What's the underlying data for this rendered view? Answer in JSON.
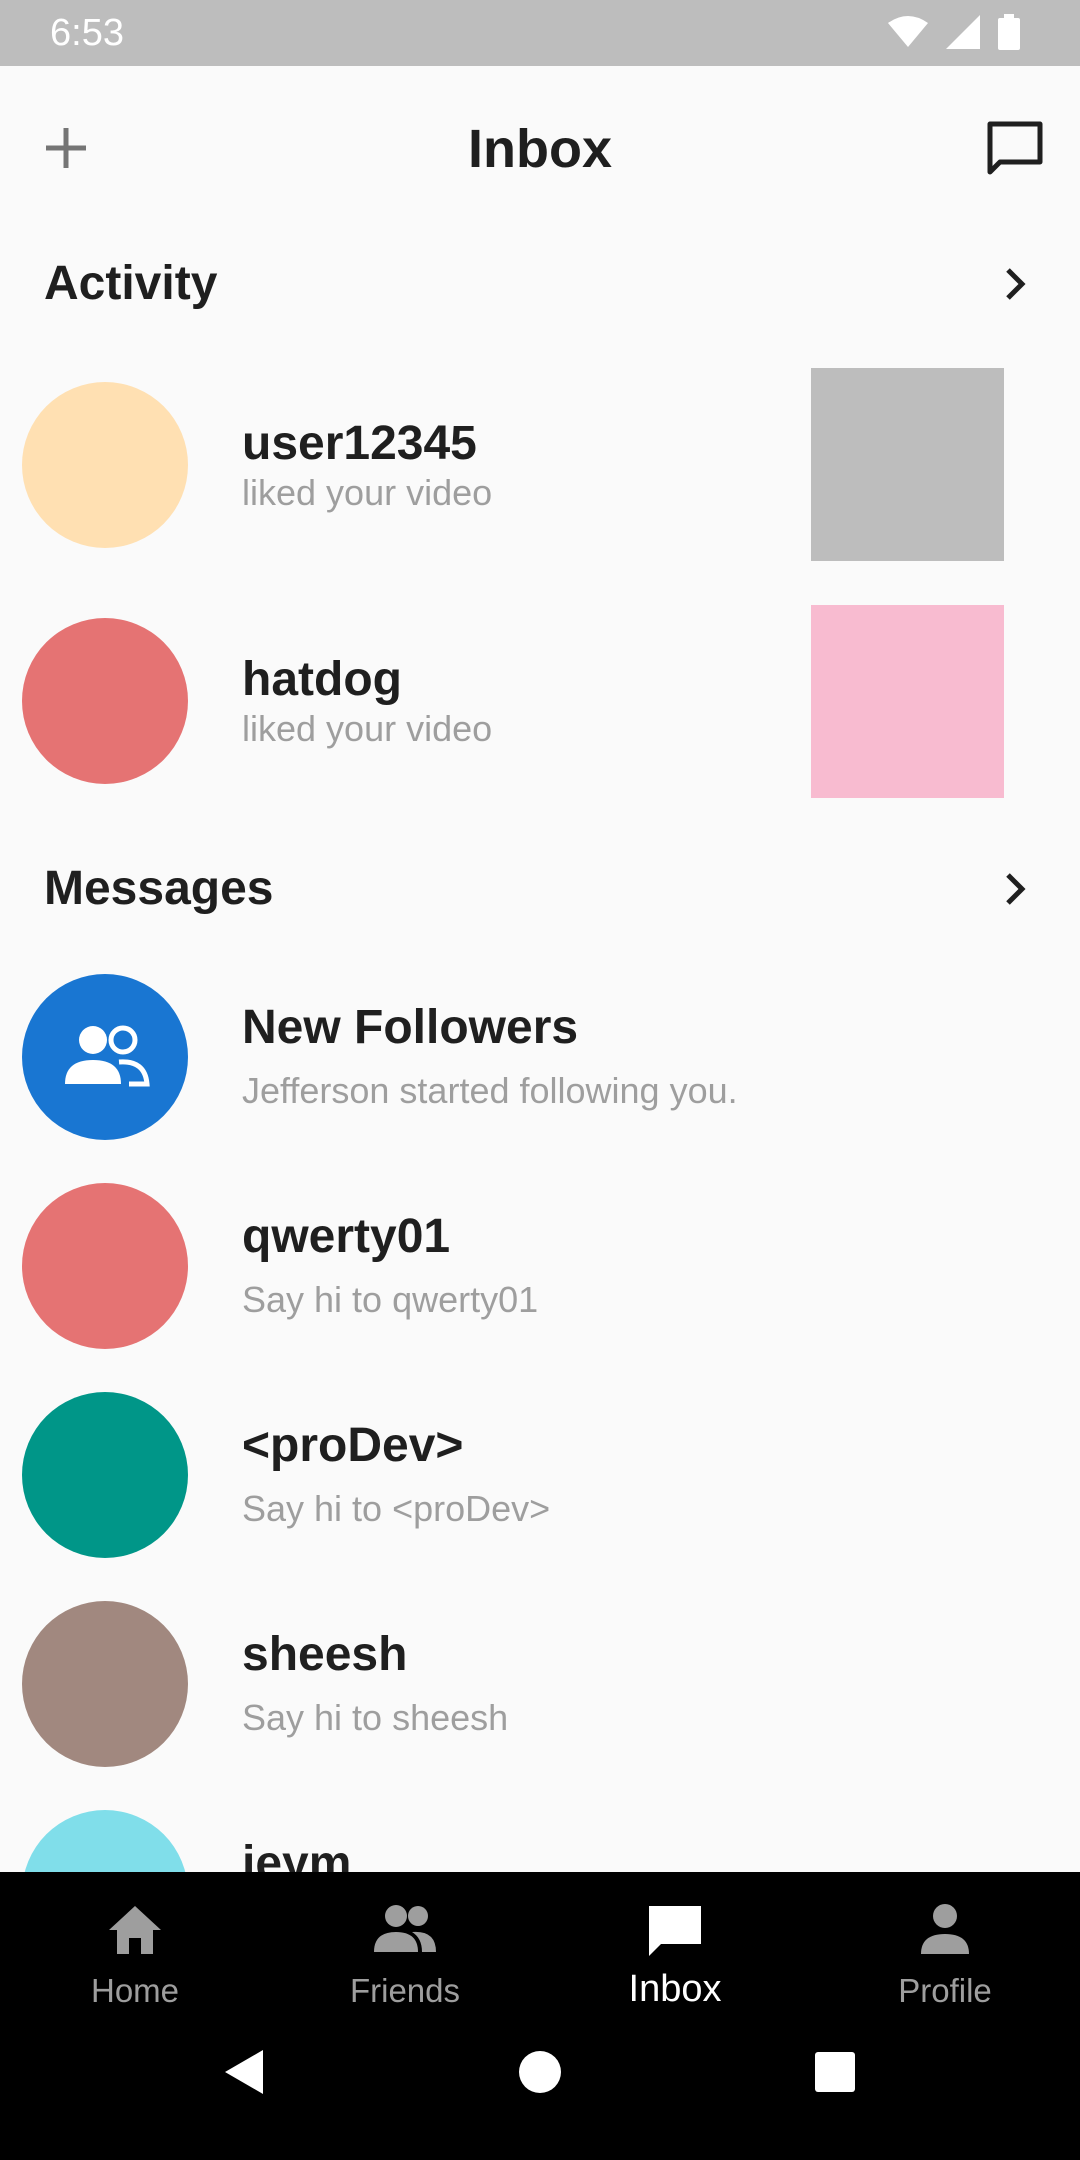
{
  "status_bar": {
    "time": "6:53"
  },
  "app_bar": {
    "title": "Inbox"
  },
  "activity": {
    "title": "Activity",
    "items": [
      {
        "name": "user12345",
        "action": "liked your video",
        "avatar_color": "#ffe0b2",
        "thumb_color": "#bdbdbd"
      },
      {
        "name": "hatdog",
        "action": "liked your video",
        "avatar_color": "#e57373",
        "thumb_color": "#f8bbd0"
      }
    ]
  },
  "messages": {
    "title": "Messages",
    "new_followers": {
      "title": "New Followers",
      "subtitle": "Jefferson started following you.",
      "avatar_color": "#1976d2"
    },
    "items": [
      {
        "name": "qwerty01",
        "subtitle": "Say hi to qwerty01",
        "avatar_color": "#e57373"
      },
      {
        "name": "<proDev>",
        "subtitle": "Say hi to <proDev>",
        "avatar_color": "#009688"
      },
      {
        "name": "sheesh",
        "subtitle": "Say hi to sheesh",
        "avatar_color": "#a1887f"
      },
      {
        "name": "jeym",
        "subtitle": "",
        "avatar_color": "#80deea"
      }
    ]
  },
  "bottom_nav": {
    "items": [
      {
        "label": "Home",
        "icon": "home-icon"
      },
      {
        "label": "Friends",
        "icon": "friends-icon"
      },
      {
        "label": "Inbox",
        "icon": "inbox-icon",
        "active": true
      },
      {
        "label": "Profile",
        "icon": "profile-icon"
      }
    ]
  },
  "colors": {
    "accent": "#1976d2",
    "status_bar": "#bdbdbd",
    "nav_bg": "#000000"
  }
}
